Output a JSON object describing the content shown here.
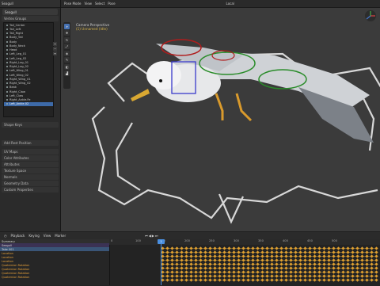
{
  "left_panel": {
    "header_items": [
      "Seagull"
    ],
    "object_name": "Seagull",
    "vertex_groups_title": "Vertex Groups",
    "vertex_groups": [
      "Tail_Center",
      "Tail_Left",
      "Tail_Right",
      "Body_Tail",
      "Body",
      "Body_Neck",
      "Head",
      "Left_Leg_01",
      "Left_Leg_02",
      "Right_Leg_01",
      "Right_Leg_02",
      "Left_Wing_01",
      "Left_Wing_02",
      "Right_Wing_01",
      "Right_Wing_02",
      "Beak",
      "Right_Claw",
      "Left_Claw",
      "Right_Ankle.Fe",
      "Left_Ankle.02"
    ],
    "selected_index": 19,
    "sections": [
      "Shape Keys",
      "Add Rest Position",
      "UV Maps",
      "Color Attributes",
      "Attributes",
      "Texture Space",
      "Normals",
      "Geometry Data",
      "Custom Properties"
    ]
  },
  "viewport": {
    "header": [
      "Pose Mode",
      "View",
      "Select",
      "Pose"
    ],
    "header_right": [
      "Local"
    ],
    "info_title": "Camera Perspective",
    "info_sub": "(1) Unnamed (Idle)",
    "tools": [
      "cursor",
      "move",
      "rotate",
      "scale",
      "transform",
      "annotate",
      "measure",
      "relax"
    ]
  },
  "timeline": {
    "header": [
      "Playback",
      "Keying",
      "View",
      "Marker"
    ],
    "current_frame": "1",
    "ruler_ticks": [
      "0",
      "100",
      "150",
      "200",
      "250",
      "300",
      "350",
      "400",
      "450",
      "500"
    ],
    "channels": [
      {
        "label": "Summary",
        "kind": "sum"
      },
      {
        "label": "Seagull",
        "kind": "obj"
      },
      {
        "label": "Take 001",
        "kind": "act"
      },
      {
        "label": "Location",
        "kind": "ch"
      },
      {
        "label": "Location",
        "kind": "ch"
      },
      {
        "label": "Location",
        "kind": "ch"
      },
      {
        "label": "Quaternion Rotation",
        "kind": "ch"
      },
      {
        "label": "Quaternion Rotation",
        "kind": "ch"
      },
      {
        "label": "Quaternion Rotation",
        "kind": "ch"
      },
      {
        "label": "Quaternion Rotation",
        "kind": "ch"
      }
    ]
  },
  "colors": {
    "accent": "#4772b3",
    "keyframe": "#e0a030"
  }
}
